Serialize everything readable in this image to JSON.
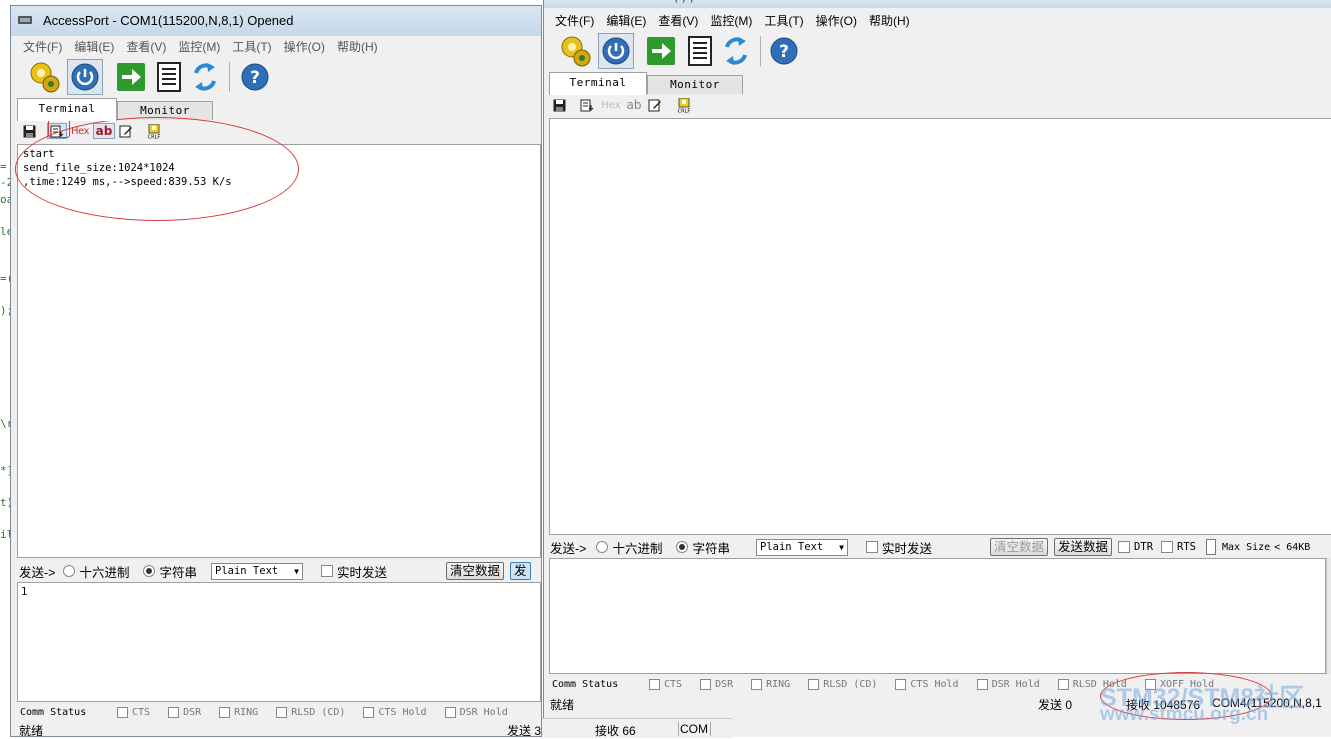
{
  "background_code": [
    "=",
    "-2",
    "oa",
    "le",
    "=(",
    ");",
    "\\r",
    "*]",
    "t)",
    "il"
  ],
  "win1": {
    "title": "AccessPort - COM1(115200,N,8,1) Opened",
    "menu": [
      "文件(F)",
      "编辑(E)",
      "查看(V)",
      "监控(M)",
      "工具(T)",
      "操作(O)",
      "帮助(H)"
    ],
    "tabs": [
      "Terminal",
      "Monitor"
    ],
    "receive_lines": [
      "start",
      "send_file_size:1024*1024",
      ",time:1249 ms,-->speed:839.53 K/s"
    ],
    "send_label": "发送->",
    "radio_hex": "十六进制",
    "radio_string": "字符串",
    "format_select": "Plain Text",
    "realtime_label": "实时发送",
    "clear_button": "清空数据",
    "send_button": "发",
    "send_text": "1",
    "comm_label": "Comm Status",
    "comm_items": [
      "CTS",
      "DSR",
      "RING",
      "RLSD (CD)",
      "CTS Hold",
      "DSR Hold"
    ],
    "status_ready": "就绪",
    "status_sent": "发送 3",
    "status_received": "接收 66",
    "status_port": "COM"
  },
  "win2": {
    "title_fragment": "( ) )",
    "menu": [
      "文件(F)",
      "编辑(E)",
      "查看(V)",
      "监控(M)",
      "工具(T)",
      "操作(O)",
      "帮助(H)"
    ],
    "tabs": [
      "Terminal",
      "Monitor"
    ],
    "send_label": "发送->",
    "radio_hex": "十六进制",
    "radio_string": "字符串",
    "format_select": "Plain Text",
    "realtime_label": "实时发送",
    "clear_button": "清空数据",
    "send_button": "发送数据",
    "dtr_label": "DTR",
    "rts_label": "RTS",
    "max_size_label": "Max Size",
    "max_size_value": "< 64KB",
    "comm_label": "Comm Status",
    "comm_items": [
      "CTS",
      "DSR",
      "RING",
      "RLSD (CD)",
      "CTS Hold",
      "DSR Hold",
      "RLSD Hold",
      "XOFF Hold"
    ],
    "status_ready": "就绪",
    "status_sent": "发送 0",
    "status_received": "接收 1048576",
    "status_port": "COM4(115200,N,8,1"
  },
  "watermark": {
    "line1": "STM32/STM8社区",
    "line2": "www.stmcu.org.cn"
  },
  "icons": {
    "app": "serial-port-icon",
    "gears": "gear-settings-icon",
    "power": "power-icon",
    "send": "green-arrow-icon",
    "doc": "document-icon",
    "refresh": "refresh-icon",
    "help": "help-icon"
  },
  "colors": {
    "annotation": "#d83a3a",
    "accent_blue": "#2b6cb8",
    "green": "#2e9a2e"
  }
}
